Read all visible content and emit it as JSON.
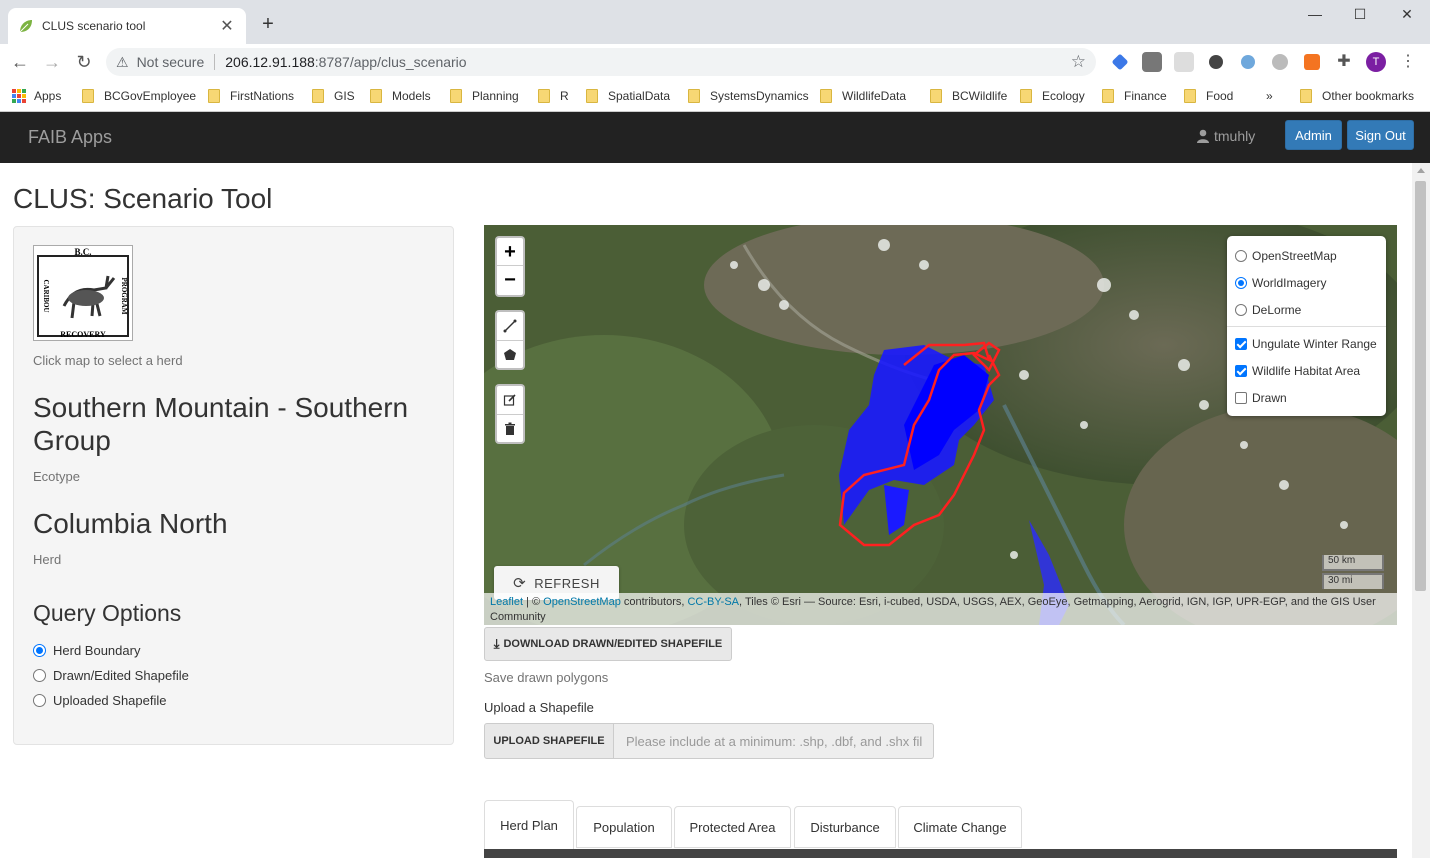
{
  "browser": {
    "tab_title": "CLUS scenario tool",
    "tab_close": "✕",
    "new_tab": "+",
    "security_label": "Not secure",
    "url_host": "206.12.91.188",
    "url_rest": ":8787/app/clus_scenario",
    "bookmarks": [
      {
        "label": "Apps"
      },
      {
        "label": "BCGovEmployee"
      },
      {
        "label": "FirstNations"
      },
      {
        "label": "GIS"
      },
      {
        "label": "Models"
      },
      {
        "label": "Planning"
      },
      {
        "label": "R"
      },
      {
        "label": "SpatialData"
      },
      {
        "label": "SystemsDynamics"
      },
      {
        "label": "WildlifeData"
      },
      {
        "label": "BCWildlife"
      },
      {
        "label": "Ecology"
      },
      {
        "label": "Finance"
      },
      {
        "label": "Food"
      },
      {
        "label": "»"
      },
      {
        "label": "Other bookmarks"
      }
    ],
    "profile_initial": "T",
    "accent_color": "#337ab7"
  },
  "navbar": {
    "brand": "FAIB Apps",
    "user": "tmuhly",
    "admin_label": "Admin",
    "signout_label": "Sign Out"
  },
  "page": {
    "title": "CLUS: Scenario Tool",
    "logo_text_top": "B.C.",
    "logo_text_left": "CARIBOU",
    "logo_text_right": "PROGRAM",
    "logo_text_bottom": "RECOVERY",
    "click_hint": "Click map to select a herd",
    "ecotype_value": "Southern Mountain - Southern Group",
    "ecotype_label": "Ecotype",
    "herd_value": "Columbia North",
    "herd_label": "Herd",
    "query_heading": "Query Options",
    "query_options": [
      {
        "label": "Herd Boundary",
        "selected": true
      },
      {
        "label": "Drawn/Edited Shapefile",
        "selected": false
      },
      {
        "label": "Uploaded Shapefile",
        "selected": false
      }
    ]
  },
  "map": {
    "zoom_in": "+",
    "zoom_out": "−",
    "base_layers": [
      {
        "label": "OpenStreetMap",
        "selected": false
      },
      {
        "label": "WorldImagery",
        "selected": true
      },
      {
        "label": "DeLorme",
        "selected": false
      }
    ],
    "overlays": [
      {
        "label": "Ungulate Winter Range",
        "checked": true
      },
      {
        "label": "Wildlife Habitat Area",
        "checked": true
      },
      {
        "label": "Drawn",
        "checked": false
      }
    ],
    "refresh_label": "REFRESH",
    "scale_km": "50 km",
    "scale_mi": "30 mi",
    "attribution_leaflet": "Leaflet",
    "attribution_sep": " | © ",
    "attribution_osm": "OpenStreetMap",
    "attribution_contrib": " contributors, ",
    "attribution_cc": "CC-BY-SA",
    "attribution_rest": ", Tiles © Esri — Source: Esri, i-cubed, USDA, USGS, AEX, GeoEye, Getmapping, Aerogrid, IGN, IGP, UPR-EGP, and the GIS User Community"
  },
  "actions": {
    "download_label": "DOWNLOAD DRAWN/EDITED SHAPEFILE",
    "save_hint": "Save drawn polygons",
    "upload_heading": "Upload a Shapefile",
    "upload_button": "UPLOAD SHAPEFILE",
    "upload_placeholder": "Please include at a minimum: .shp, .dbf, and .shx fil"
  },
  "tabs": [
    {
      "label": "Herd Plan",
      "active": true
    },
    {
      "label": "Population",
      "active": false
    },
    {
      "label": "Protected Area",
      "active": false
    },
    {
      "label": "Disturbance",
      "active": false
    },
    {
      "label": "Climate Change",
      "active": false
    }
  ]
}
